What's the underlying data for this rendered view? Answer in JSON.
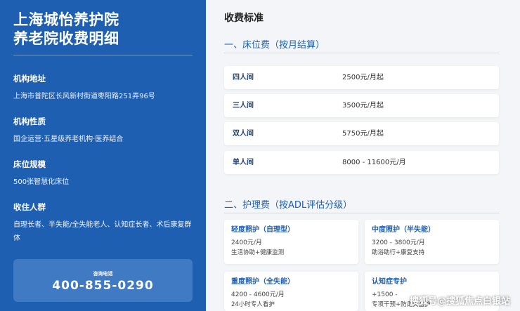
{
  "sidebar": {
    "title_line1": "上海城怡养护院",
    "title_line2": "养老院收费明细",
    "sections": [
      {
        "label": "机构地址",
        "value": "上海市普陀区长风新村街道枣阳路251弄96号"
      },
      {
        "label": "机构性质",
        "value": "国企运营·五星级养老机构·医养结合"
      },
      {
        "label": "床位规模",
        "value": "500张智慧化床位"
      },
      {
        "label": "收住人群",
        "value": "自理长者、半失能/全失能老人、认知症长者、术后康复群体"
      }
    ],
    "contact": {
      "label": "咨询电话",
      "phone": "400-855-0290"
    }
  },
  "main": {
    "title": "收费标准",
    "bed_section": {
      "heading": "一、床位费（按月结算）",
      "rows": [
        {
          "name": "四人间",
          "price": "2500元/月起"
        },
        {
          "name": "三人间",
          "price": "3500元/月起"
        },
        {
          "name": "双人间",
          "price": "5750元/月起"
        },
        {
          "name": "单人间",
          "price": "8000 - 11600元/月"
        }
      ]
    },
    "care_section": {
      "heading": "二、护理费（按ADL评估分级）",
      "cards": [
        {
          "name": "轻度照护（自理型）",
          "price": "2400元/月",
          "desc": "生活协助+健康监测"
        },
        {
          "name": "中度照护（半失能）",
          "price": "3200 - 3800元/月",
          "desc": "助浴助行+康复支持"
        },
        {
          "name": "重度照护（全失能）",
          "price": "4200 - 4600元/月",
          "desc": "24小时专人看护"
        },
        {
          "name": "认知症专护",
          "price": "+1500 - ",
          "desc": "专项干预+防走失监护"
        }
      ]
    }
  },
  "watermark": "搜狐号@搜狐焦点白银站"
}
